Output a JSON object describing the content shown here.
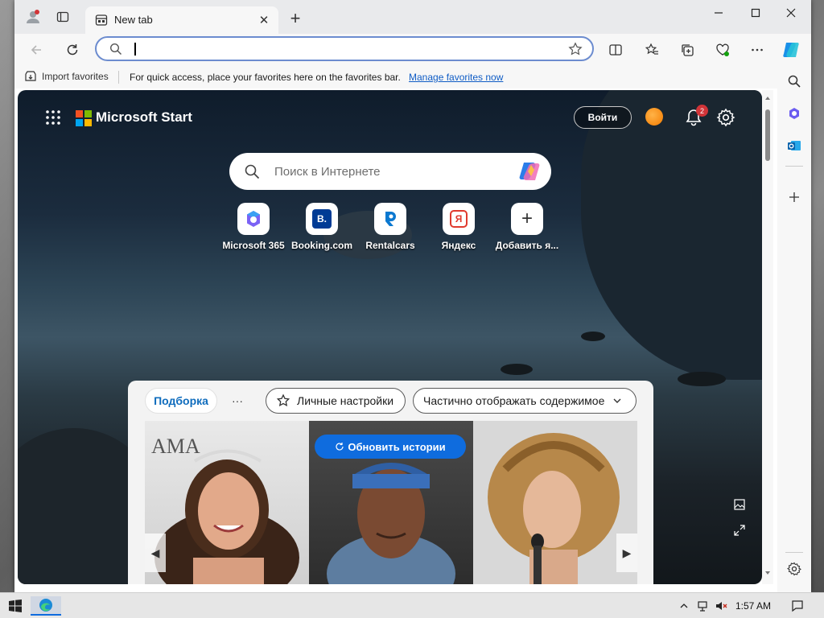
{
  "tabs": [
    {
      "title": "New tab",
      "active": true
    }
  ],
  "omnibox": {
    "value": "",
    "placeholder": ""
  },
  "favorites_bar": {
    "import_label": "Import favorites",
    "message": "For quick access, place your favorites here on the favorites bar.",
    "manage_link": "Manage favorites now"
  },
  "start_page": {
    "brand": "Microsoft Start",
    "signin_label": "Войти",
    "notification_count": "2",
    "search_placeholder": "Поиск в Интернете",
    "quick_links": [
      {
        "label": "Microsoft 365",
        "icon": "microsoft-365-icon"
      },
      {
        "label": "Booking.com",
        "icon": "booking-icon",
        "glyph": "B."
      },
      {
        "label": "Rentalcars",
        "icon": "rentalcars-icon"
      },
      {
        "label": "Яндекс",
        "icon": "yandex-icon",
        "glyph": "Я"
      },
      {
        "label": "Добавить я...",
        "icon": "plus-icon",
        "glyph": "+"
      }
    ],
    "feed": {
      "tabs": {
        "active": "Подборка",
        "more": "···"
      },
      "personalize_label": "Личные настройки",
      "content_display_label": "Частично отображать содержимое",
      "refresh_label": "Обновить истории"
    }
  },
  "taskbar": {
    "time": "1:57 AM"
  },
  "colors": {
    "accent": "#0f6cde",
    "link": "#0f5cc5",
    "badge": "#d13438"
  }
}
